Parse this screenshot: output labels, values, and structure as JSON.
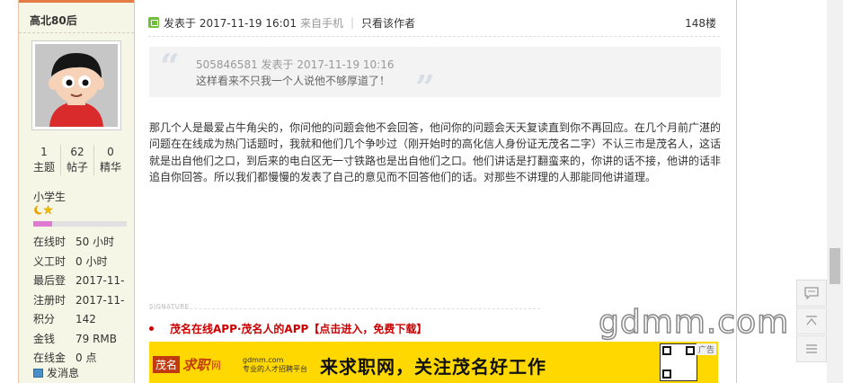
{
  "user": {
    "name": "高北80后",
    "stats": [
      {
        "num": "1",
        "label": "主题"
      },
      {
        "num": "62",
        "label": "帖子"
      },
      {
        "num": "0",
        "label": "精华"
      }
    ],
    "rank": "小学生",
    "stars_icon": "moon-star-icon",
    "level_progress": 0.2,
    "info": [
      {
        "key": "在线时",
        "value": "50 小时"
      },
      {
        "key": "义工时",
        "value": "0 小时"
      },
      {
        "key": "最后登",
        "value": "2017-11-"
      },
      {
        "key": "注册时",
        "value": "2017-11-"
      },
      {
        "key": "积分",
        "value": "142"
      },
      {
        "key": "金钱",
        "value": "79 RMB"
      },
      {
        "key": "在线金",
        "value": "0 点"
      }
    ],
    "send_message": "发消息"
  },
  "post": {
    "posted_at": "发表于 2017-11-19 16:01",
    "source": "来自手机",
    "divider": "|",
    "author_only": "只看该作者",
    "floor": "148楼",
    "quote": {
      "meta": "505846581 发表于 2017-11-19 10:16",
      "text": "这样看来不只我一个人说他不够厚道了！"
    },
    "body": "那几个人是最爱占牛角尖的，你问他的问题会他不会回答，他问你的问题会天天复读直到你不再回应。在几个月前广湛的问题在在线成为热门话题时，我就和他们几个争吵过（刚开始时的高化信人身份证无茂名二字）不认三市是茂名人，这话就是出自他们之口，到后来的电白区无一寸铁路也是出自他们之口。他们讲话是打翻蛮来的，你讲的话不接，他讲的话非追自你回答。所以我们都慢慢的发表了自己的意见而不回答他们的话。对那些不讲理的人那能同他讲道理。",
    "signature_label": "SIGNATURE",
    "signature_link": "茂名在线APP·茂名人的APP【点击进入，免费下载】"
  },
  "banner": {
    "logo_box": "茂名",
    "logo_text": "求职",
    "logo_suffix": "网",
    "site": "gdmm.com",
    "site_sub": "专业的人才招聘平台",
    "slogan": "来求职网，关注茂名好工作",
    "ad_tag": "广告"
  },
  "watermark": "gdmm.com",
  "tools": [
    "comment-icon",
    "back-to-top-icon",
    "list-icon"
  ]
}
